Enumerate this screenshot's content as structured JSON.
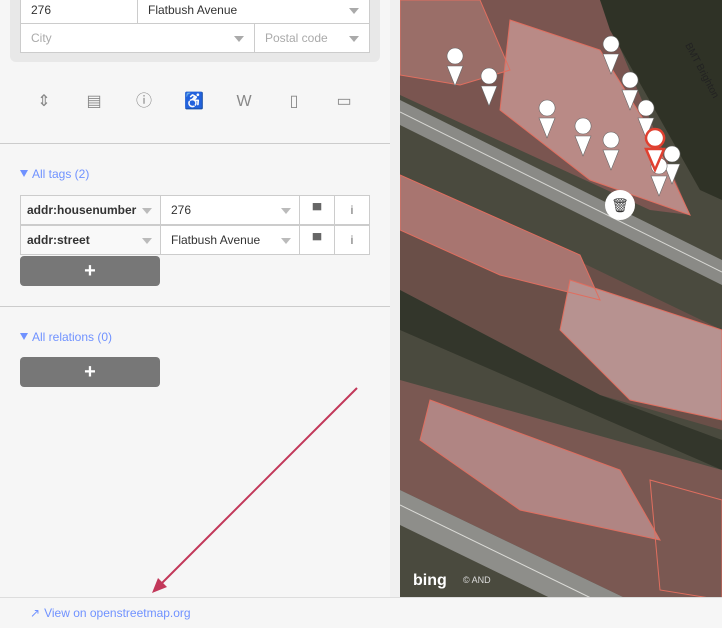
{
  "address": {
    "housenumber": "276",
    "street": "Flatbush Avenue",
    "city_placeholder": "City",
    "postal_placeholder": "Postal code"
  },
  "preset_icons": [
    "move-icon",
    "note-icon",
    "info-circle-icon",
    "wheelchair-icon",
    "wikipedia-icon",
    "phone-icon",
    "laptop-icon"
  ],
  "preset_glyphs": [
    "⇕",
    "▤",
    "ⓘ",
    "♿",
    "W",
    "▯",
    "▭"
  ],
  "tags": {
    "header": "All tags (2)",
    "rows": [
      {
        "key": "addr:housenumber",
        "value": "276"
      },
      {
        "key": "addr:street",
        "value": "Flatbush Avenue"
      }
    ],
    "add_label": "+"
  },
  "relations": {
    "header": "All relations (0)",
    "add_label": "+"
  },
  "footer": {
    "link_label": "View on openstreetmap.org"
  },
  "map": {
    "street_label": "BMT Brighton",
    "attribution_brand": "bing",
    "attribution_text": "© AND",
    "trash_glyph": "🗑"
  },
  "colors": {
    "accent": "#7092ff",
    "button_gray": "#777777",
    "annotation_arrow": "#c2385a",
    "building_outline": "#e06e5f"
  }
}
